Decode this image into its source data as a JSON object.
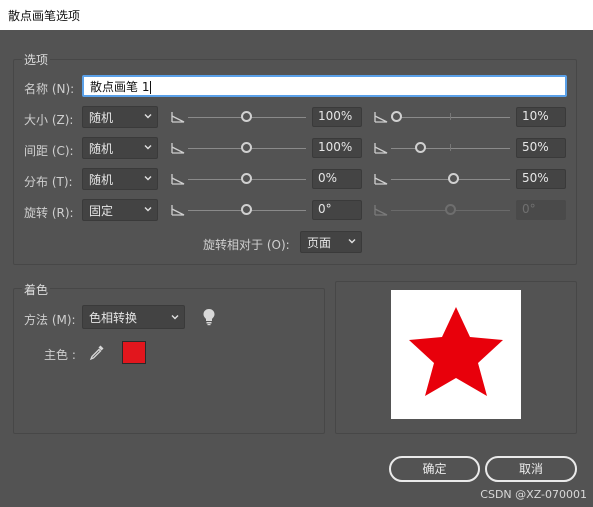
{
  "window": {
    "title": "散点画笔选项"
  },
  "options_group": {
    "legend": "选项",
    "name_label": "名称 (N):",
    "name_value": "散点画笔 1",
    "rows": [
      {
        "key": "size",
        "label": "大小 (Z):",
        "mode": "随机",
        "min_value": "100%",
        "max_value": "10%"
      },
      {
        "key": "spacing",
        "label": "间距 (C):",
        "mode": "随机",
        "min_value": "100%",
        "max_value": "50%"
      },
      {
        "key": "scatter",
        "label": "分布 (T):",
        "mode": "随机",
        "min_value": "0%",
        "max_value": "50%"
      },
      {
        "key": "rotation",
        "label": "旋转 (R):",
        "mode": "固定",
        "min_value": "0°",
        "max_value": "0°"
      }
    ],
    "rotation_relative_label": "旋转相对于 (O):",
    "rotation_relative_value": "页面"
  },
  "colorization_group": {
    "legend": "着色",
    "method_label": "方法 (M):",
    "method_value": "色相转换",
    "key_color_label": "主色 :",
    "key_color": "#e2161d"
  },
  "preview": {
    "star_color": "#e8000b"
  },
  "buttons": {
    "ok": "确定",
    "cancel": "取消"
  },
  "watermark": "CSDN @XZ-070001",
  "icons": [
    "pressure-icon",
    "chevron-down-icon",
    "bulb-icon",
    "eyedropper-icon",
    "star-preview"
  ]
}
